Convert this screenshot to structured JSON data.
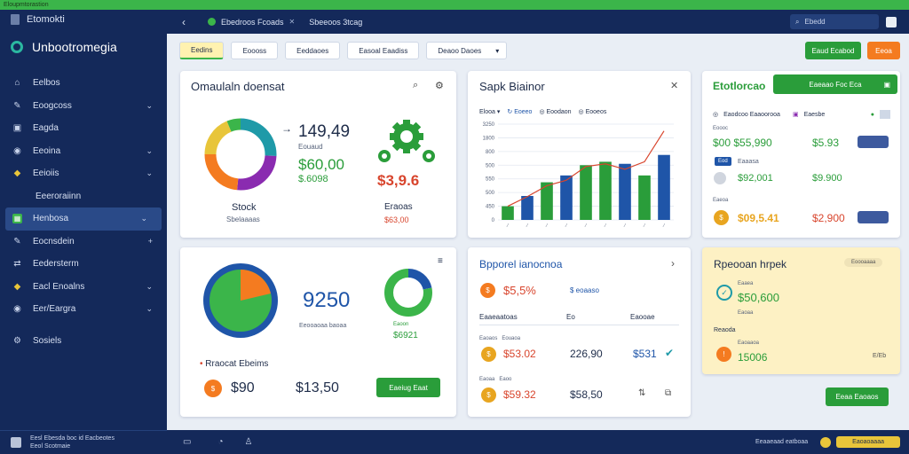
{
  "top_strip": {
    "title": "Eloupmtorastion"
  },
  "sidebar": {
    "brand": "Etomokti",
    "app_name": "Unbootromegia",
    "items": [
      {
        "label": "Eelbos",
        "icon": "home-icon",
        "chevron": false
      },
      {
        "label": "Eoogcoss",
        "icon": "pencil-icon",
        "chevron": true
      },
      {
        "label": "Eagda",
        "icon": "image-icon",
        "chevron": false
      },
      {
        "label": "Eeoina",
        "icon": "compass-icon",
        "chevron": true
      },
      {
        "label": "Eeioiis",
        "icon": "tag-icon",
        "chevron": true
      },
      {
        "label": "Eeeroraiinn",
        "icon": "",
        "chevron": false,
        "sub": true
      },
      {
        "label": "Henbosa",
        "icon": "grid-icon",
        "chevron": true,
        "active": true
      },
      {
        "label": "Eocnsdein",
        "icon": "pencil-icon",
        "chevron": true,
        "chevron_glyph": "+"
      },
      {
        "label": "Eedersterm",
        "icon": "share-icon",
        "chevron": false
      },
      {
        "label": "Eacl Enoalns",
        "icon": "tag-icon",
        "chevron": true
      },
      {
        "label": "Eer/Eargra",
        "icon": "compass-icon",
        "chevron": true
      },
      {
        "label": "Sosiels",
        "icon": "gear-icon",
        "chevron": false
      }
    ],
    "footer": {
      "line1": "Eesl Ebesda boc id Eacbeotes",
      "line2": "Eeol Scotmaie"
    }
  },
  "topbar": {
    "tab1": "Ebedroos Fcoads",
    "tab2": "Sbeeoos 3tcag",
    "search_placeholder": "Ebedd"
  },
  "toolbar": {
    "chips": [
      "Eedins",
      "Eoooss",
      "Eeddaoes",
      "Easoal Eaadiss"
    ],
    "select_label": "Deaoo Daoes",
    "btn_primary": "Eaud Ecabod",
    "btn_secondary": "Eeoa"
  },
  "card1": {
    "title": "Omaulaln doensat",
    "big_value": "149,49",
    "big_sub": "Eouaud",
    "value_green": "$60,00",
    "value_green2": "$.6098",
    "value_red": "$3,9.6",
    "donut_title": "Stock",
    "donut_sub": "Sbelaaaas",
    "gear_title": "Eraoas",
    "gear_sub": "$63,00"
  },
  "card2": {
    "title": "Sapk Biainor",
    "filter1": "Elooa",
    "filter2": "Eoeeo",
    "filter3": "Eoodaon",
    "filter4": "Eooeos",
    "y_ticks": [
      "3250",
      "1800",
      "800",
      "500",
      "550",
      "500",
      "450",
      "0"
    ]
  },
  "card3": {
    "title": "Etotlorcao",
    "green_btn": "Eaeaao Foc Eca",
    "header_label": "Eaodcoo Eaaoorooa",
    "header_label2": "Eaesbe",
    "row1_label": "Eoooc",
    "row1_value": "$00 $55,990",
    "row1_value2": "$5.93",
    "row2_tag": "Eod",
    "row2_label": "Eaaasa",
    "row2_value": "$92,001",
    "row2_value2": "$9.900",
    "row3_label": "Eaeoa",
    "row3_value": "$09,5.41",
    "row3_value2": "$2,900"
  },
  "card4": {
    "value": "9250",
    "sub": "Eeooaoaa baoaa",
    "ring_value": "$6921",
    "ring_label": "Eaoon",
    "bullet": "Rraocat Ebeims",
    "price1": "$90",
    "price2": "$13,50",
    "btn": "Eaeiug Eaat"
  },
  "card5": {
    "title": "Bpporel ianocnoa",
    "val1": "$5,5%",
    "val1_tag": "$ eoaaso",
    "col1": "Eaaeaatoas",
    "col2": "Eo",
    "col3": "Eaooae",
    "row1_label": "Eaoaos",
    "row1_sub": "Eouaoa",
    "row1_v1": "$53.02",
    "row1_v2": "226,90",
    "row1_v3": "$531",
    "row2_label": "Eaoaa",
    "row2_sub": "Eaoo",
    "row2_v1": "$59.32",
    "row2_v2": "$58,50"
  },
  "card6": {
    "title": "Rpeooan hrpek",
    "badge": "Eoooaaaa",
    "label1": "Eaaea",
    "value1": "$50,600",
    "label2": "Eaoaa",
    "label3": "Reaoda",
    "label4": "Eaoaaoa",
    "value2": "15006",
    "corner": "E/Eb",
    "btn": "Eeaa Eaoaos"
  },
  "statusbar": {
    "right_text": "Eeaaeaad eatboaa",
    "pill": "Eaoaoaaaa"
  },
  "chart_data": {
    "type": "bar",
    "title": "Sapk Biainor",
    "y_ticks": [
      "3250",
      "1800",
      "800",
      "500",
      "550",
      "500",
      "450",
      "0"
    ],
    "values": [
      20,
      35,
      55,
      65,
      80,
      85,
      82,
      65,
      95
    ],
    "colors": [
      "#2a9d3a",
      "#1f55a8",
      "#2a9d3a",
      "#1f55a8",
      "#2a9d3a",
      "#2a9d3a",
      "#1f55a8",
      "#2a9d3a",
      "#1f55a8"
    ],
    "line_values": [
      20,
      34,
      50,
      58,
      78,
      82,
      74,
      85,
      130
    ],
    "line_color": "#d8452d"
  },
  "colors": {
    "sidebar": "#14295a",
    "accent_green": "#3bb54a",
    "accent_orange": "#f47b20",
    "accent_blue": "#1f55a8",
    "accent_red": "#d8452d"
  }
}
